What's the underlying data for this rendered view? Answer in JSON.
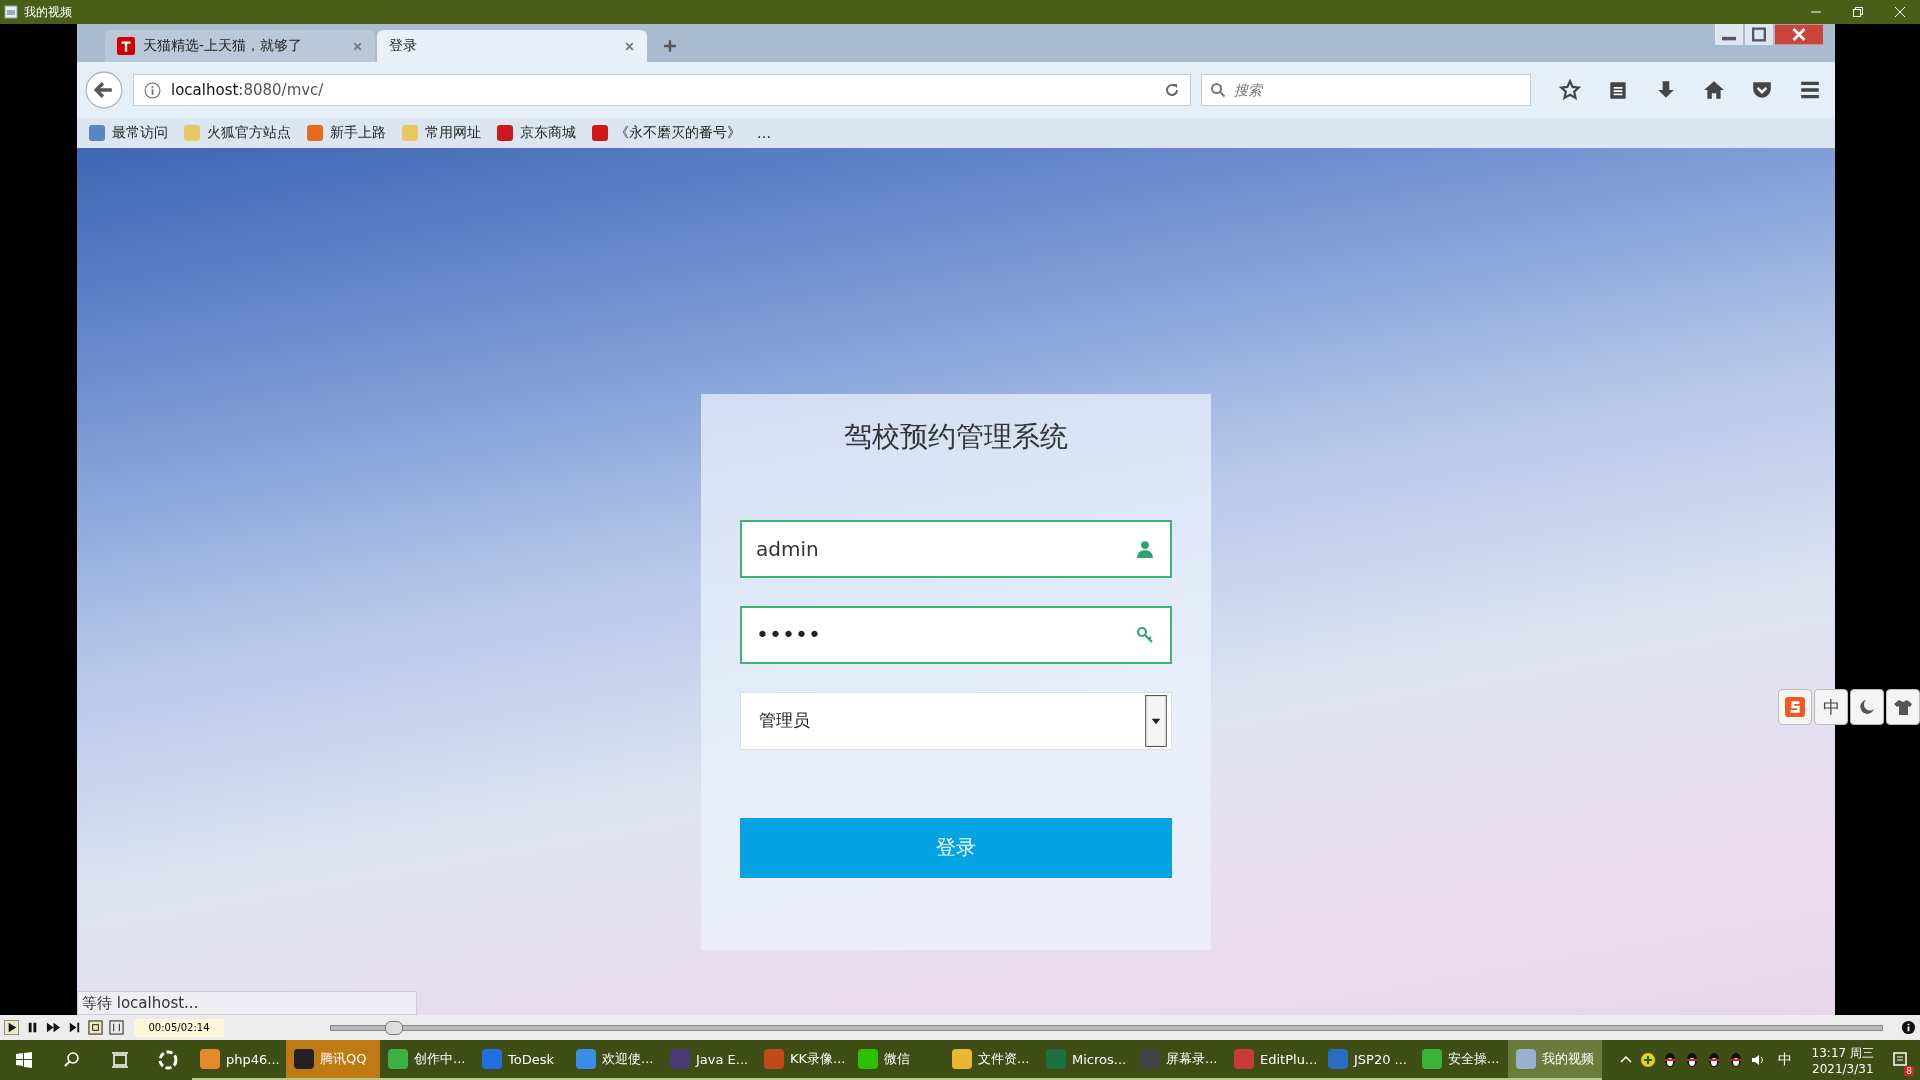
{
  "player": {
    "title": "我的视频",
    "time": "00:05/02:14",
    "level": 0.04
  },
  "browser": {
    "tabs": [
      {
        "label": "天猫精选-上天猫，就够了",
        "selected": false
      },
      {
        "label": "登录",
        "selected": true
      }
    ],
    "url_host": "localhost",
    "url_rest": ":8080/mvc/",
    "search_placeholder": "搜索",
    "bookmarks": [
      {
        "label": "最常访问",
        "color": "#5a86c0"
      },
      {
        "label": "火狐官方站点",
        "color": "#e8c860"
      },
      {
        "label": "新手上路",
        "color": "#e66a1e"
      },
      {
        "label": "常用网址",
        "color": "#e8c860"
      },
      {
        "label": "京东商城",
        "color": "#cc1a1a"
      },
      {
        "label": "《永不磨灭的番号》",
        "color": "#d01818"
      }
    ],
    "bookmarks_more": "…",
    "status": "等待 localhost..."
  },
  "login": {
    "title": "驾校预约管理系统",
    "username": "admin",
    "password_mask": "•••••",
    "role": "管理员",
    "submit": "登录"
  },
  "ime": {
    "mode": "中"
  },
  "taskbar": {
    "items": [
      {
        "label": "php46...",
        "color": "#e58a2a",
        "selected": false,
        "kind": "app"
      },
      {
        "label": "腾讯QQ",
        "color": "#222222",
        "selected": false,
        "kind": "attention"
      },
      {
        "label": "创作中...",
        "color": "#3cb043",
        "selected": false,
        "kind": "app"
      },
      {
        "label": "ToDesk",
        "color": "#1f6fe0",
        "selected": false,
        "kind": "app"
      },
      {
        "label": "欢迎使...",
        "color": "#3a8ee6",
        "selected": false,
        "kind": "app"
      },
      {
        "label": "Java E...",
        "color": "#4a3a78",
        "selected": false,
        "kind": "app"
      },
      {
        "label": "KK录像...",
        "color": "#c04a1a",
        "selected": false,
        "kind": "app"
      },
      {
        "label": "微信",
        "color": "#2dc100",
        "selected": false,
        "kind": "app"
      },
      {
        "label": "文件资...",
        "color": "#e8b830",
        "selected": false,
        "kind": "app"
      },
      {
        "label": "Micros...",
        "color": "#1d7044",
        "selected": false,
        "kind": "app"
      },
      {
        "label": "屏幕录...",
        "color": "#444444",
        "selected": false,
        "kind": "app"
      },
      {
        "label": "EditPlu...",
        "color": "#c83a3a",
        "selected": false,
        "kind": "app"
      },
      {
        "label": "JSP20 ...",
        "color": "#2a6cc0",
        "selected": false,
        "kind": "app"
      },
      {
        "label": "安全操...",
        "color": "#3bb33b",
        "selected": false,
        "kind": "app"
      },
      {
        "label": "我的视频",
        "color": "#9ab0d0",
        "selected": true,
        "kind": "app"
      }
    ],
    "tray_lang": "中",
    "time": "13:17 周三",
    "date": "2021/3/31",
    "notification_count": "8"
  }
}
